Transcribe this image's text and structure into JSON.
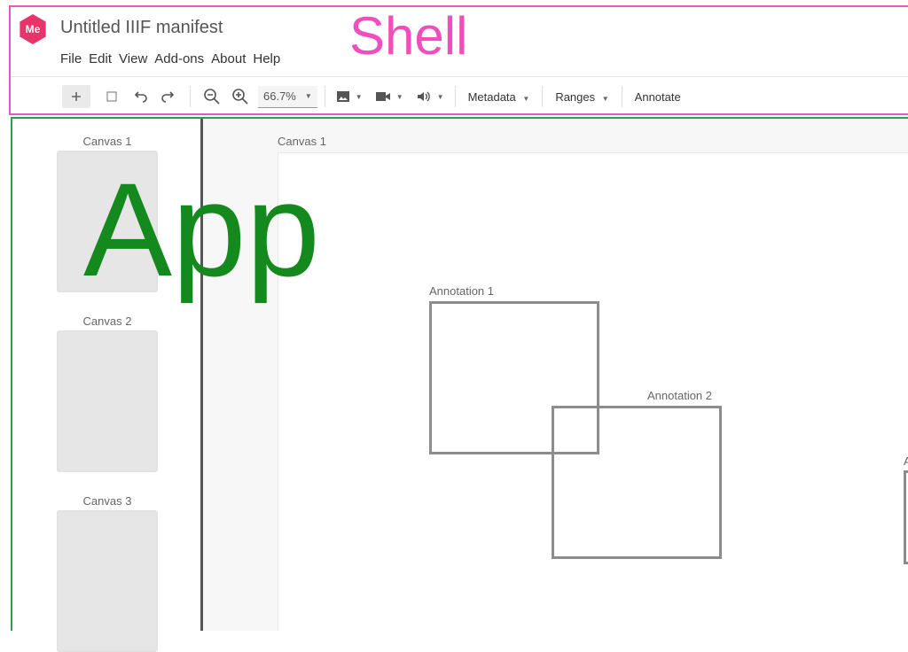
{
  "shell": {
    "logo_text": "Me",
    "title": "Untitled IIIF manifest",
    "menu": [
      "File",
      "Edit",
      "View",
      "Add-ons",
      "About",
      "Help"
    ],
    "region_label": "Shell",
    "region_color": "#ef4fbd",
    "toolbar": {
      "add_icon": "plus-icon",
      "select_icon": "square-icon",
      "undo_icon": "undo-icon",
      "redo_icon": "redo-icon",
      "zoom_out_icon": "zoom-out-icon",
      "zoom_in_icon": "zoom-in-icon",
      "zoom_value": "66.7%",
      "image_icon": "image-icon",
      "video_icon": "video-icon",
      "audio_icon": "audio-icon",
      "metadata_label": "Metadata",
      "ranges_label": "Ranges",
      "annotate_label": "Annotate"
    }
  },
  "app": {
    "region_label": "App",
    "region_color": "#14891e",
    "sidebar": {
      "thumbnails": [
        {
          "label": "Canvas 1"
        },
        {
          "label": "Canvas 2"
        },
        {
          "label": "Canvas 3"
        }
      ]
    },
    "main": {
      "canvas_label": "Canvas 1",
      "annotations": [
        {
          "label": "Annotation 1"
        },
        {
          "label": "Annotation 2"
        },
        {
          "label": "A"
        }
      ]
    }
  }
}
